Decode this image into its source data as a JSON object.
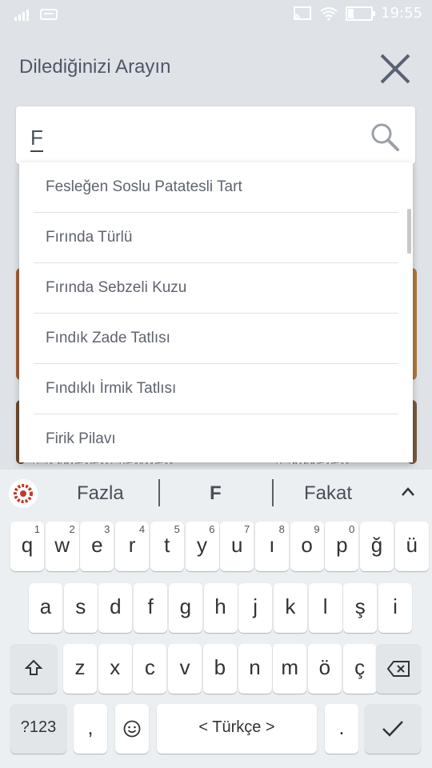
{
  "status": {
    "time": "19:55"
  },
  "header": {
    "title": "Dilediğinizi Arayın"
  },
  "search": {
    "value": "F"
  },
  "dropdown": {
    "items": [
      "Fesleğen Soslu Patatesli Tart",
      "Fırında Türlü",
      "Fırında Sebzeli Kuzu",
      "Fındık Zade Tatlısı",
      "Fındıklı İrmik Tatlısı",
      "Firik Pilavı"
    ]
  },
  "background": {
    "label_left": "Çikolatalı Tatlılar",
    "label_right": "Çorbalar"
  },
  "keyboard": {
    "suggestions": [
      "Fazla",
      "F",
      "Fakat"
    ],
    "row1": [
      [
        "q",
        "1"
      ],
      [
        "w",
        "2"
      ],
      [
        "e",
        "3"
      ],
      [
        "r",
        "4"
      ],
      [
        "t",
        "5"
      ],
      [
        "y",
        "6"
      ],
      [
        "u",
        "7"
      ],
      [
        "ı",
        "8"
      ],
      [
        "o",
        "9"
      ],
      [
        "p",
        "0"
      ],
      [
        "ğ",
        ""
      ],
      [
        "ü",
        ""
      ]
    ],
    "row2": [
      "a",
      "s",
      "d",
      "f",
      "g",
      "h",
      "j",
      "k",
      "l",
      "ş",
      "i"
    ],
    "row3": [
      "z",
      "x",
      "c",
      "v",
      "b",
      "n",
      "m",
      "ö",
      "ç"
    ],
    "symbols_label": "?123",
    "comma": ",",
    "space_label": "<  Türkçe  >",
    "period": "."
  },
  "colors": {
    "accent": "#50566a",
    "keyboard_bg": "#eceff1",
    "page_bg": "#dfe3e7"
  }
}
